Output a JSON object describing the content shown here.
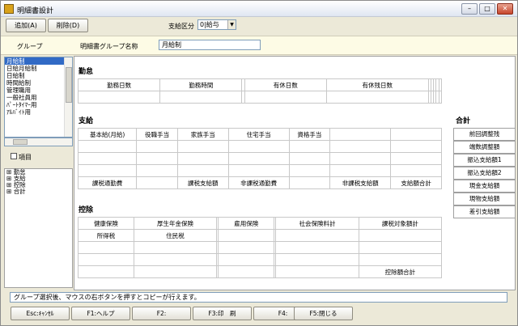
{
  "window": {
    "title": "明細書設計"
  },
  "toolbar": {
    "add": "追加(A)",
    "delete": "削除(D)",
    "pay_type_label": "支給区分",
    "pay_type_value": "0|給与"
  },
  "group": {
    "header": "グループ",
    "name_label": "明細書グループ名称",
    "name_value": "月給制"
  },
  "list": {
    "items": [
      "月給制",
      "日給月給制",
      "日給制",
      "時間給制",
      "管理職用",
      "一般社員用",
      "ﾊﾟｰﾄﾀｲﾏｰ用",
      "ｱﾙﾊﾞｲﾄ用"
    ],
    "selected": 0
  },
  "item_check": {
    "label": "項目"
  },
  "tree": {
    "nodes": [
      "勤怠",
      "支給",
      "控除",
      "合計"
    ],
    "expander": "⊞"
  },
  "sections": {
    "attendance": {
      "title": "勤怠",
      "row1": [
        "勤務日数",
        "勤務時間",
        "",
        "有休日数",
        "有休残日数",
        "",
        "",
        "",
        "",
        ""
      ]
    },
    "payment": {
      "title": "支給",
      "row1": [
        "基本給(月給)",
        "役職手当",
        "家族手当",
        "住宅手当",
        "資格手当",
        "",
        ""
      ],
      "row5": [
        "課税通勤費",
        "",
        "課税支給額",
        "非課税通勤費",
        "",
        "非課税支給額",
        "支給額合計"
      ]
    },
    "deduction": {
      "title": "控除",
      "row1": [
        "健康保険",
        "厚生年金保険",
        "",
        "雇用保険",
        "",
        "社会保険料計",
        "課税対象額計"
      ],
      "row2": [
        "所得税",
        "住民税",
        "",
        "",
        "",
        "",
        ""
      ],
      "row5": [
        "",
        "",
        "",
        "",
        "",
        "",
        "控除額合計"
      ]
    }
  },
  "totals": {
    "title": "合計",
    "items": [
      "前回調整残",
      "端数調整額",
      "振込支給額1",
      "振込支給額2",
      "現金支給額",
      "現物支給額",
      "差引支給額"
    ]
  },
  "status": {
    "message": "グループ選択後、マウスの右ボタンを押すとコピーが行えます。"
  },
  "fkeys": {
    "esc": "Esc:ｷｬﾝｾﾙ",
    "f1": "F1:ヘルプ",
    "f2": "F2:",
    "f3": "F3:印　刷",
    "f4": "F4:",
    "f5": "F5:閉じる"
  }
}
